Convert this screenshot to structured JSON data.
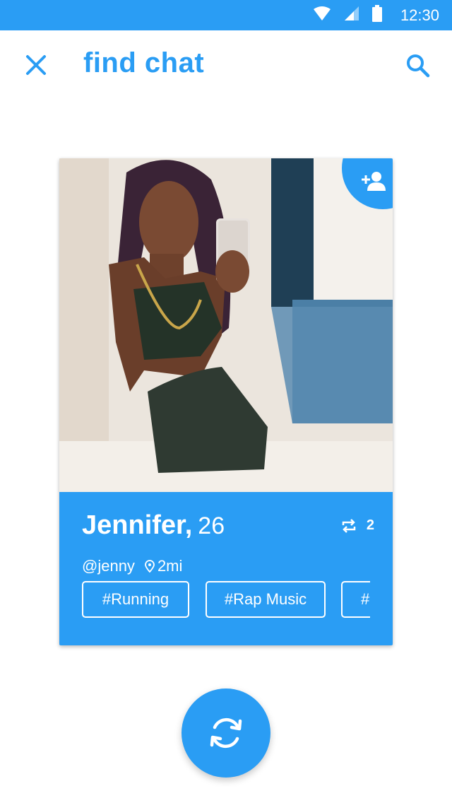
{
  "status_bar": {
    "time": "12:30",
    "icons": [
      "wifi-icon",
      "signal-icon",
      "battery-icon"
    ]
  },
  "app_bar": {
    "title": "find chat",
    "left_icon": "close-icon",
    "right_icon": "search-icon"
  },
  "profile": {
    "name": "Jennifer,",
    "age": "26",
    "handle": "@jenny",
    "distance": "2mi",
    "repeat_count": "2",
    "tags": [
      "#Running",
      "#Rap Music",
      "#"
    ]
  },
  "colors": {
    "accent": "#2a9df4",
    "background": "#ffffff",
    "text_on_accent": "#ffffff"
  }
}
